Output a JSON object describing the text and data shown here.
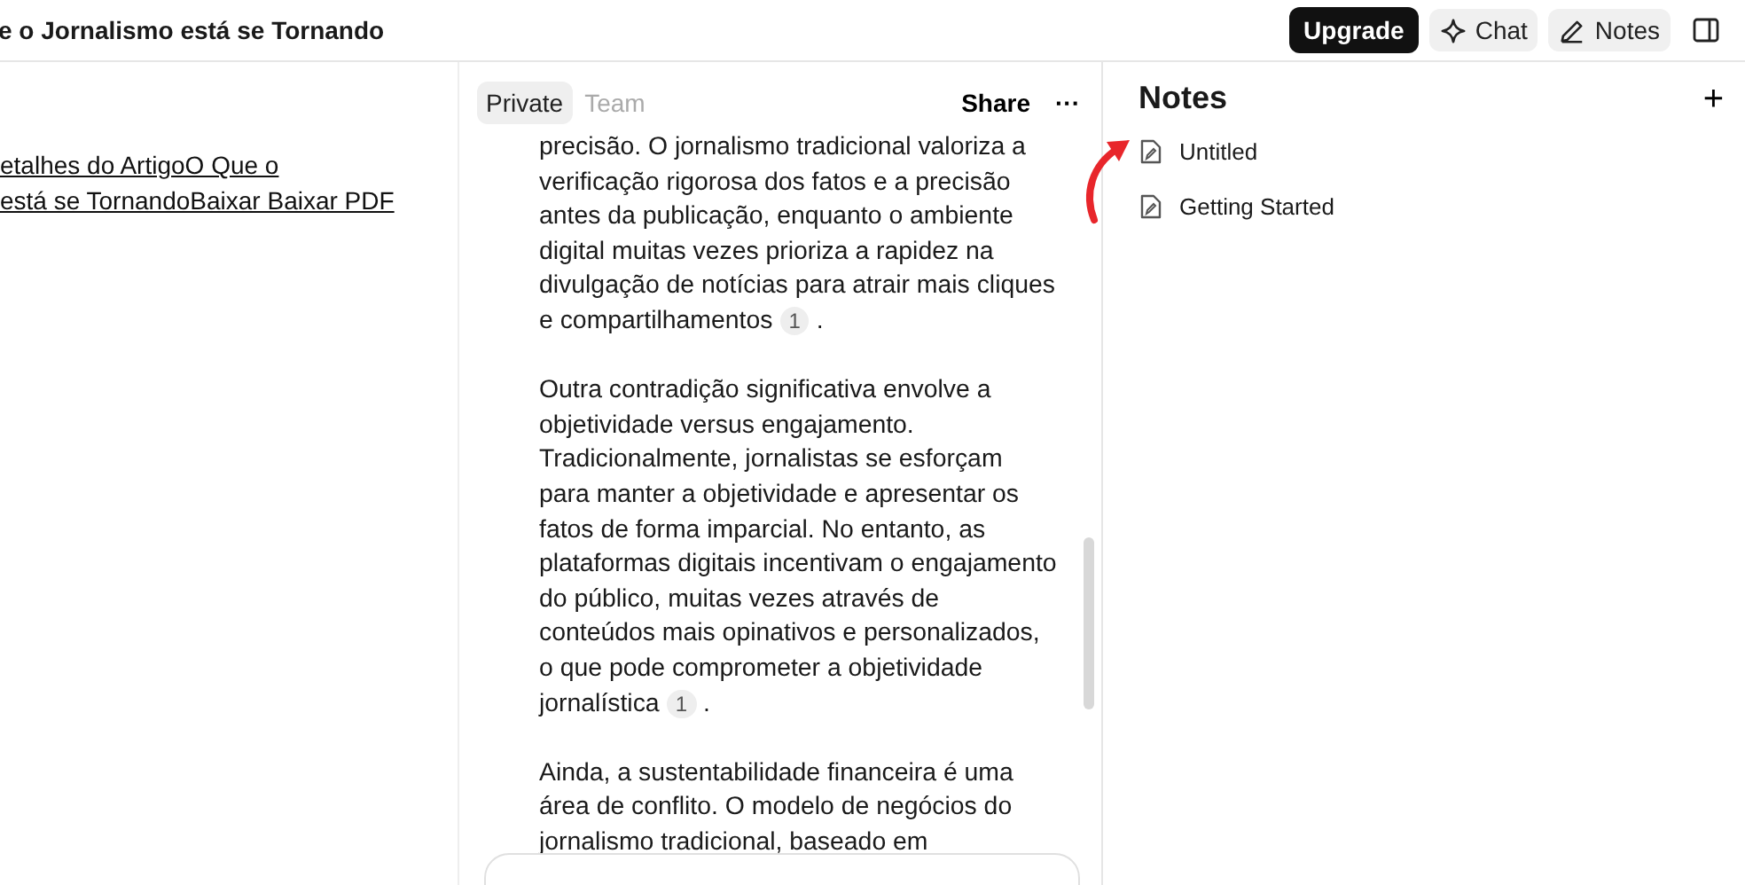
{
  "header": {
    "title": "e o Jornalismo está se Tornando",
    "buttons": [
      {
        "kind": "upgrade",
        "label": "Upgrade"
      },
      {
        "kind": "chat",
        "label": "Chat"
      },
      {
        "kind": "notes",
        "label": "Notes"
      }
    ]
  },
  "left": {
    "links": [
      "etalhes do ArtigoO Que o",
      "está se TornandoBaixar Baixar PDF"
    ]
  },
  "middle": {
    "tabs": [
      {
        "label": "Private",
        "selected": true
      },
      {
        "label": "Team",
        "selected": false
      }
    ],
    "share": "Share",
    "more": "···",
    "paragraphs": [
      {
        "text": "precisão. O jornalismo tradicional valoriza a verificação rigorosa dos fatos e a precisão antes da publicação, enquanto o ambiente digital muitas vezes prioriza a rapidez na divulgação de notícias para atrair mais cliques e compartilhamentos",
        "citation": "1",
        "end": "."
      },
      {
        "text": "Outra contradição significativa envolve a objetividade versus engajamento. Tradicionalmente, jornalistas se esforçam para manter a objetividade e apresentar os fatos de forma imparcial. No entanto, as plataformas digitais incentivam o engajamento do público, muitas vezes através de conteúdos mais opinativos e personalizados, o que pode comprometer a objetividade jornalística",
        "citation": "1",
        "end": "."
      },
      {
        "text": "Ainda, a sustentabilidade financeira é uma área de conflito. O modelo de negócios do jornalismo tradicional, baseado em"
      }
    ]
  },
  "notes": {
    "title": "Notes",
    "add": "+",
    "items": [
      "Untitled",
      "Getting Started"
    ]
  }
}
